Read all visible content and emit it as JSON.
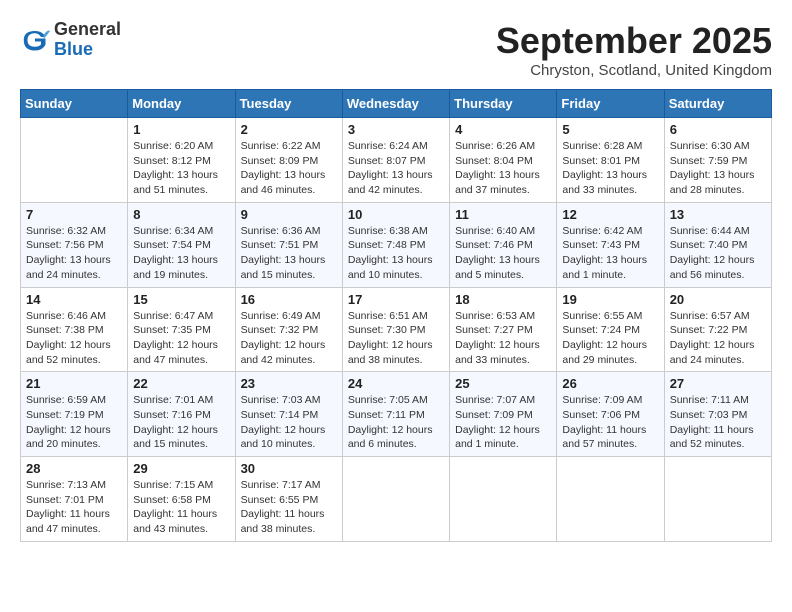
{
  "header": {
    "logo_general": "General",
    "logo_blue": "Blue",
    "month_title": "September 2025",
    "location": "Chryston, Scotland, United Kingdom"
  },
  "weekdays": [
    "Sunday",
    "Monday",
    "Tuesday",
    "Wednesday",
    "Thursday",
    "Friday",
    "Saturday"
  ],
  "weeks": [
    [
      {
        "day": "",
        "info": ""
      },
      {
        "day": "1",
        "info": "Sunrise: 6:20 AM\nSunset: 8:12 PM\nDaylight: 13 hours\nand 51 minutes."
      },
      {
        "day": "2",
        "info": "Sunrise: 6:22 AM\nSunset: 8:09 PM\nDaylight: 13 hours\nand 46 minutes."
      },
      {
        "day": "3",
        "info": "Sunrise: 6:24 AM\nSunset: 8:07 PM\nDaylight: 13 hours\nand 42 minutes."
      },
      {
        "day": "4",
        "info": "Sunrise: 6:26 AM\nSunset: 8:04 PM\nDaylight: 13 hours\nand 37 minutes."
      },
      {
        "day": "5",
        "info": "Sunrise: 6:28 AM\nSunset: 8:01 PM\nDaylight: 13 hours\nand 33 minutes."
      },
      {
        "day": "6",
        "info": "Sunrise: 6:30 AM\nSunset: 7:59 PM\nDaylight: 13 hours\nand 28 minutes."
      }
    ],
    [
      {
        "day": "7",
        "info": "Sunrise: 6:32 AM\nSunset: 7:56 PM\nDaylight: 13 hours\nand 24 minutes."
      },
      {
        "day": "8",
        "info": "Sunrise: 6:34 AM\nSunset: 7:54 PM\nDaylight: 13 hours\nand 19 minutes."
      },
      {
        "day": "9",
        "info": "Sunrise: 6:36 AM\nSunset: 7:51 PM\nDaylight: 13 hours\nand 15 minutes."
      },
      {
        "day": "10",
        "info": "Sunrise: 6:38 AM\nSunset: 7:48 PM\nDaylight: 13 hours\nand 10 minutes."
      },
      {
        "day": "11",
        "info": "Sunrise: 6:40 AM\nSunset: 7:46 PM\nDaylight: 13 hours\nand 5 minutes."
      },
      {
        "day": "12",
        "info": "Sunrise: 6:42 AM\nSunset: 7:43 PM\nDaylight: 13 hours\nand 1 minute."
      },
      {
        "day": "13",
        "info": "Sunrise: 6:44 AM\nSunset: 7:40 PM\nDaylight: 12 hours\nand 56 minutes."
      }
    ],
    [
      {
        "day": "14",
        "info": "Sunrise: 6:46 AM\nSunset: 7:38 PM\nDaylight: 12 hours\nand 52 minutes."
      },
      {
        "day": "15",
        "info": "Sunrise: 6:47 AM\nSunset: 7:35 PM\nDaylight: 12 hours\nand 47 minutes."
      },
      {
        "day": "16",
        "info": "Sunrise: 6:49 AM\nSunset: 7:32 PM\nDaylight: 12 hours\nand 42 minutes."
      },
      {
        "day": "17",
        "info": "Sunrise: 6:51 AM\nSunset: 7:30 PM\nDaylight: 12 hours\nand 38 minutes."
      },
      {
        "day": "18",
        "info": "Sunrise: 6:53 AM\nSunset: 7:27 PM\nDaylight: 12 hours\nand 33 minutes."
      },
      {
        "day": "19",
        "info": "Sunrise: 6:55 AM\nSunset: 7:24 PM\nDaylight: 12 hours\nand 29 minutes."
      },
      {
        "day": "20",
        "info": "Sunrise: 6:57 AM\nSunset: 7:22 PM\nDaylight: 12 hours\nand 24 minutes."
      }
    ],
    [
      {
        "day": "21",
        "info": "Sunrise: 6:59 AM\nSunset: 7:19 PM\nDaylight: 12 hours\nand 20 minutes."
      },
      {
        "day": "22",
        "info": "Sunrise: 7:01 AM\nSunset: 7:16 PM\nDaylight: 12 hours\nand 15 minutes."
      },
      {
        "day": "23",
        "info": "Sunrise: 7:03 AM\nSunset: 7:14 PM\nDaylight: 12 hours\nand 10 minutes."
      },
      {
        "day": "24",
        "info": "Sunrise: 7:05 AM\nSunset: 7:11 PM\nDaylight: 12 hours\nand 6 minutes."
      },
      {
        "day": "25",
        "info": "Sunrise: 7:07 AM\nSunset: 7:09 PM\nDaylight: 12 hours\nand 1 minute."
      },
      {
        "day": "26",
        "info": "Sunrise: 7:09 AM\nSunset: 7:06 PM\nDaylight: 11 hours\nand 57 minutes."
      },
      {
        "day": "27",
        "info": "Sunrise: 7:11 AM\nSunset: 7:03 PM\nDaylight: 11 hours\nand 52 minutes."
      }
    ],
    [
      {
        "day": "28",
        "info": "Sunrise: 7:13 AM\nSunset: 7:01 PM\nDaylight: 11 hours\nand 47 minutes."
      },
      {
        "day": "29",
        "info": "Sunrise: 7:15 AM\nSunset: 6:58 PM\nDaylight: 11 hours\nand 43 minutes."
      },
      {
        "day": "30",
        "info": "Sunrise: 7:17 AM\nSunset: 6:55 PM\nDaylight: 11 hours\nand 38 minutes."
      },
      {
        "day": "",
        "info": ""
      },
      {
        "day": "",
        "info": ""
      },
      {
        "day": "",
        "info": ""
      },
      {
        "day": "",
        "info": ""
      }
    ]
  ]
}
